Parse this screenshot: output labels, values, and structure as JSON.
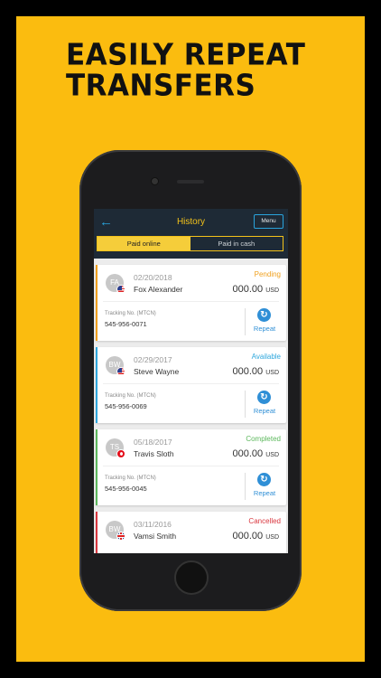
{
  "headline": {
    "line1": "EASILY REPEAT",
    "line2": "TRANSFERS"
  },
  "app": {
    "title": "History",
    "menu_label": "Menu",
    "tabs": [
      {
        "label": "Paid online",
        "active": true
      },
      {
        "label": "Paid in cash",
        "active": false
      }
    ]
  },
  "colors": {
    "background": "#fbbc0f",
    "topbar": "#1e2a36",
    "accent": "#f3c21a",
    "link": "#29a3dc"
  },
  "transfers": [
    {
      "initials": "FA",
      "flag": "us",
      "date": "02/20/2018",
      "name": "Fox Alexander",
      "status": "Pending",
      "status_color": "#f0a01e",
      "amount": "000.00",
      "currency": "USD",
      "tracking_label": "Tracking No. (MTCN)",
      "tracking": "545-956-0071",
      "repeat_label": "Repeat"
    },
    {
      "initials": "BW",
      "flag": "us",
      "date": "02/29/2017",
      "name": "Steve Wayne",
      "status": "Available",
      "status_color": "#2ea7dd",
      "amount": "000.00",
      "currency": "USD",
      "tracking_label": "Tracking No. (MTCN)",
      "tracking": "545-956-0069",
      "repeat_label": "Repeat"
    },
    {
      "initials": "TS",
      "flag": "tr",
      "date": "05/18/2017",
      "name": "Travis Sloth",
      "status": "Completed",
      "status_color": "#5cb85c",
      "amount": "000.00",
      "currency": "USD",
      "tracking_label": "Tracking No. (MTCN)",
      "tracking": "545-956-0045",
      "repeat_label": "Repeat"
    },
    {
      "initials": "BW",
      "flag": "uk",
      "date": "03/11/2016",
      "name": "Vamsi Smith",
      "status": "Cancelled",
      "status_color": "#d9363e",
      "amount": "000.00",
      "currency": "USD",
      "tracking_label": "",
      "tracking": "",
      "repeat_label": ""
    }
  ]
}
